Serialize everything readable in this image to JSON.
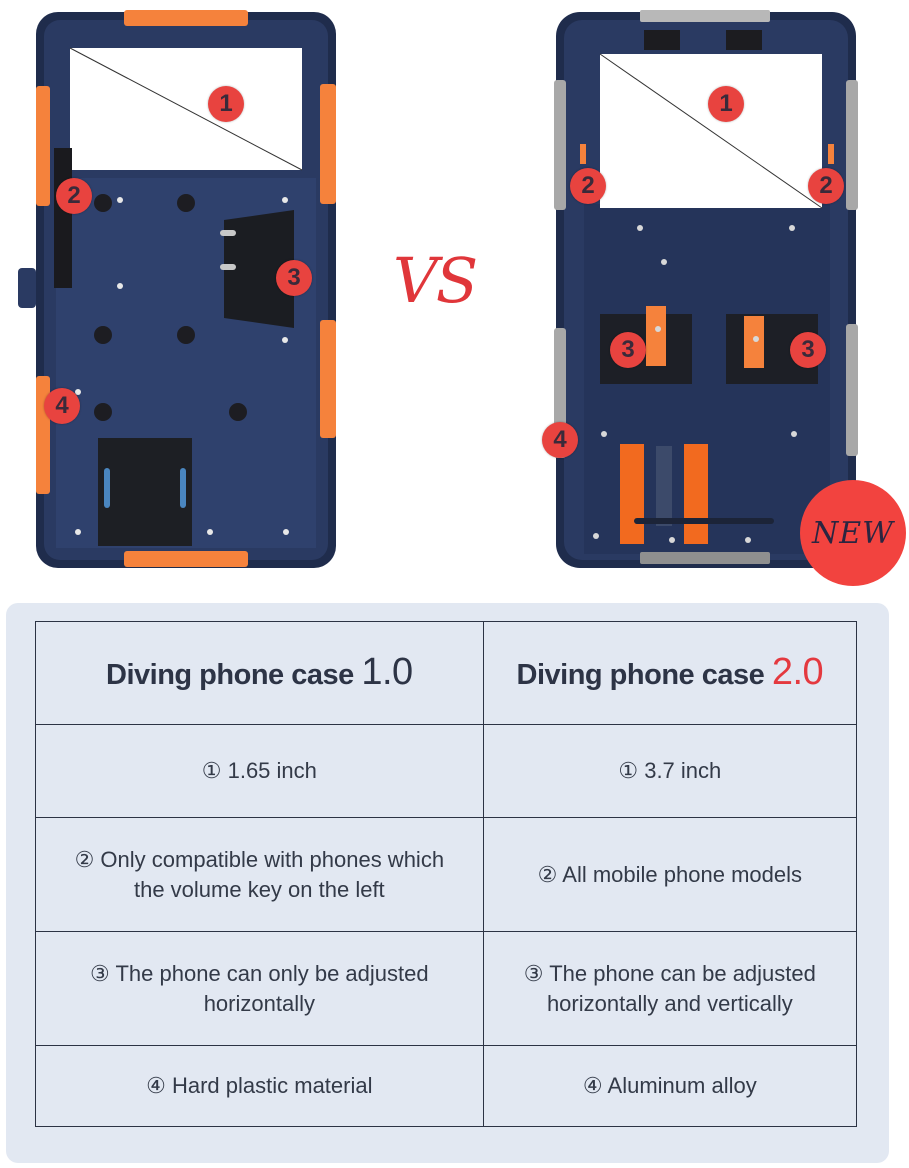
{
  "comparison": {
    "vs_label": "VS",
    "new_badge": "NEW",
    "left_product": {
      "name": "Diving phone case 1.0",
      "markers": [
        "1",
        "2",
        "3",
        "4"
      ]
    },
    "right_product": {
      "name": "Diving phone case 2.0",
      "markers": [
        "1",
        "2",
        "2",
        "3",
        "3",
        "4"
      ]
    }
  },
  "table": {
    "headers": [
      {
        "text": "Diving phone case ",
        "version": "1.0"
      },
      {
        "text": "Diving phone case ",
        "version": "2.0"
      }
    ],
    "rows": [
      [
        "① 1.65 inch",
        "① 3.7 inch"
      ],
      [
        "② Only compatible with phones which\nthe volume key on the left",
        "② All mobile phone models"
      ],
      [
        "③ The phone can only be adjusted\nhorizontally",
        "③ The phone can be adjusted\nhorizontally and vertically"
      ],
      [
        "④ Hard plastic material",
        "④ Aluminum alloy"
      ]
    ]
  },
  "colors": {
    "accent_red": "#e4393f",
    "case_navy": "#27365a",
    "case_orange": "#f5823c",
    "panel_bg": "#e2e8f2"
  }
}
